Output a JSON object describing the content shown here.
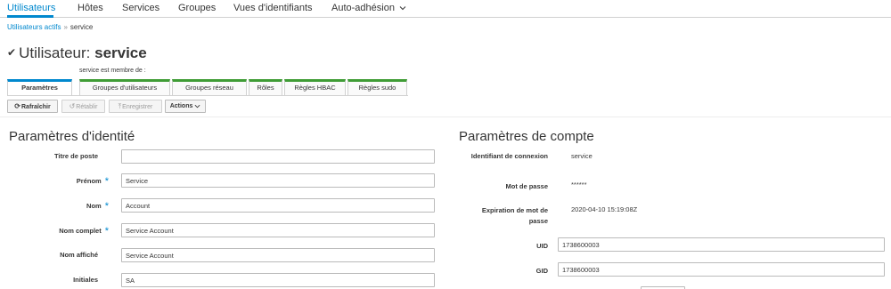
{
  "topnav": {
    "items": [
      "Utilisateurs",
      "Hôtes",
      "Services",
      "Groupes",
      "Vues d'identifiants",
      "Auto-adhésion"
    ],
    "dropdown_icon": "chevron-down-icon"
  },
  "breadcrumb": {
    "parent": "Utilisateurs actifs",
    "separator": "»",
    "current": "service"
  },
  "title": {
    "check_icon": "✔",
    "prefix": "Utilisateur:",
    "name": "service"
  },
  "member_of_label": "service est membre de :",
  "tabs": [
    "Paramètres",
    "Groupes d'utilisateurs",
    "Groupes réseau",
    "Rôles",
    "Règles HBAC",
    "Règles sudo"
  ],
  "toolbar": {
    "refresh": "Rafraîchir",
    "revert": "Rétablir",
    "save": "Enregistrer",
    "actions": "Actions"
  },
  "identity": {
    "title": "Paramètres d'identité",
    "fields": [
      {
        "label": "Titre de poste",
        "value": "",
        "required": false
      },
      {
        "label": "Prénom",
        "value": "Service",
        "required": true
      },
      {
        "label": "Nom",
        "value": "Account",
        "required": true
      },
      {
        "label": "Nom complet",
        "value": "Service Account",
        "required": true
      },
      {
        "label": "Nom affiché",
        "value": "Service Account",
        "required": false
      },
      {
        "label": "Initiales",
        "value": "SA",
        "required": false
      }
    ]
  },
  "account": {
    "title": "Paramètres de compte",
    "login_label": "Identifiant de connexion",
    "login_value": "service",
    "password_label": "Mot de passe",
    "password_value": "******",
    "expiration_label_1": "Expiration de mot de",
    "expiration_label_2": "passe",
    "expiration_value": "2020-04-10 15:19:08Z",
    "uid_label": "UID",
    "uid_value": "1738600003",
    "gid_label": "GID",
    "gid_value": "1738600003"
  },
  "colors": {
    "accent": "#0088ce",
    "tab_border": "#3f9c35"
  }
}
